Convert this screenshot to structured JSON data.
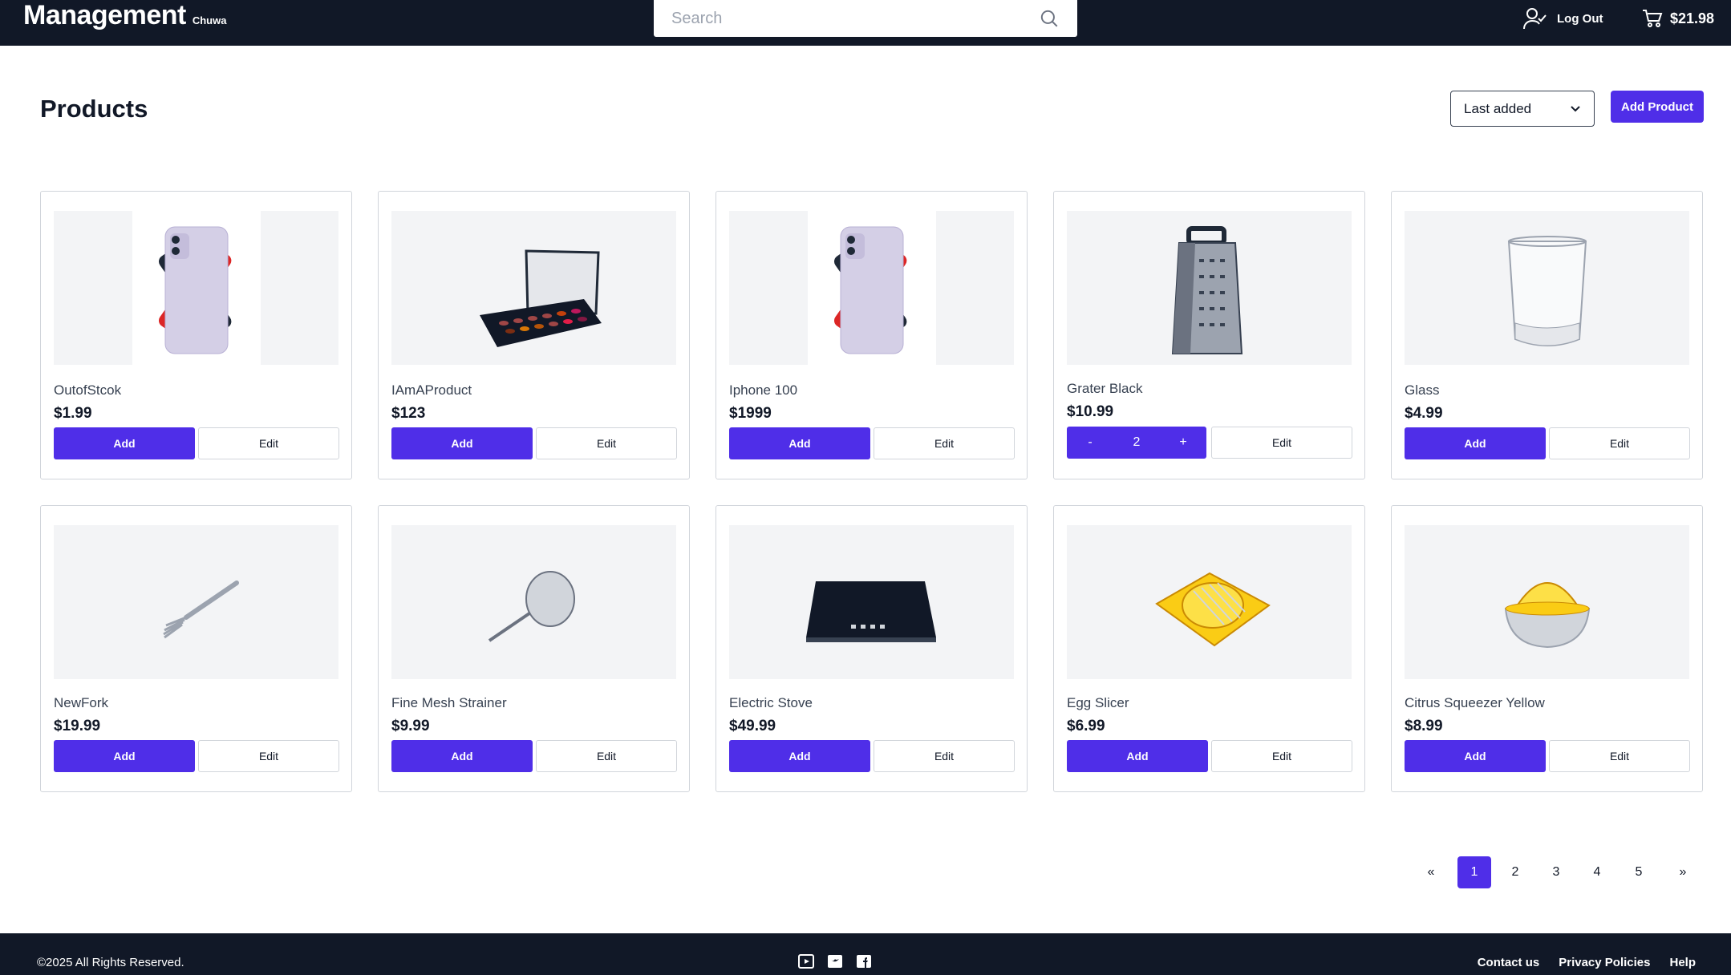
{
  "header": {
    "brand": "Management",
    "brand_sub": "Chuwa",
    "search_placeholder": "Search",
    "logout_label": "Log Out",
    "cart_total": "$21.98"
  },
  "main": {
    "title": "Products",
    "sort_selected": "Last added",
    "add_product_label": "Add Product"
  },
  "products": [
    {
      "name": "OutofStcok",
      "price": "$1.99",
      "image": "phone-icon",
      "add_label": "Add",
      "edit_label": "Edit"
    },
    {
      "name": "IAmAProduct",
      "price": "$123",
      "image": "palette-icon",
      "add_label": "Add",
      "edit_label": "Edit"
    },
    {
      "name": "Iphone 100",
      "price": "$1999",
      "image": "phone-icon",
      "add_label": "Add",
      "edit_label": "Edit"
    },
    {
      "name": "Grater Black",
      "price": "$10.99",
      "image": "grater-icon",
      "quantity": "2",
      "minus": "-",
      "plus": "+",
      "edit_label": "Edit"
    },
    {
      "name": "Glass",
      "price": "$4.99",
      "image": "glass-icon",
      "add_label": "Add",
      "edit_label": "Edit"
    },
    {
      "name": "NewFork",
      "price": "$19.99",
      "image": "fork-icon",
      "add_label": "Add",
      "edit_label": "Edit"
    },
    {
      "name": "Fine Mesh Strainer",
      "price": "$9.99",
      "image": "strainer-icon",
      "add_label": "Add",
      "edit_label": "Edit"
    },
    {
      "name": "Electric Stove",
      "price": "$49.99",
      "image": "stove-icon",
      "add_label": "Add",
      "edit_label": "Edit"
    },
    {
      "name": "Egg Slicer",
      "price": "$6.99",
      "image": "egg-slicer-icon",
      "add_label": "Add",
      "edit_label": "Edit"
    },
    {
      "name": "Citrus Squeezer Yellow",
      "price": "$8.99",
      "image": "citrus-squeezer-icon",
      "add_label": "Add",
      "edit_label": "Edit"
    }
  ],
  "pagination": {
    "first": "«",
    "pages": [
      "1",
      "2",
      "3",
      "4",
      "5"
    ],
    "active_page": "1",
    "last": "»"
  },
  "footer": {
    "copyright": "©2025 All Rights Reserved.",
    "socials": [
      "youtube-icon",
      "twitter-icon",
      "facebook-icon"
    ],
    "links": [
      "Contact us",
      "Privacy Policies",
      "Help"
    ]
  },
  "colors": {
    "nav_bg": "#111827",
    "accent": "#4f2ee8"
  }
}
